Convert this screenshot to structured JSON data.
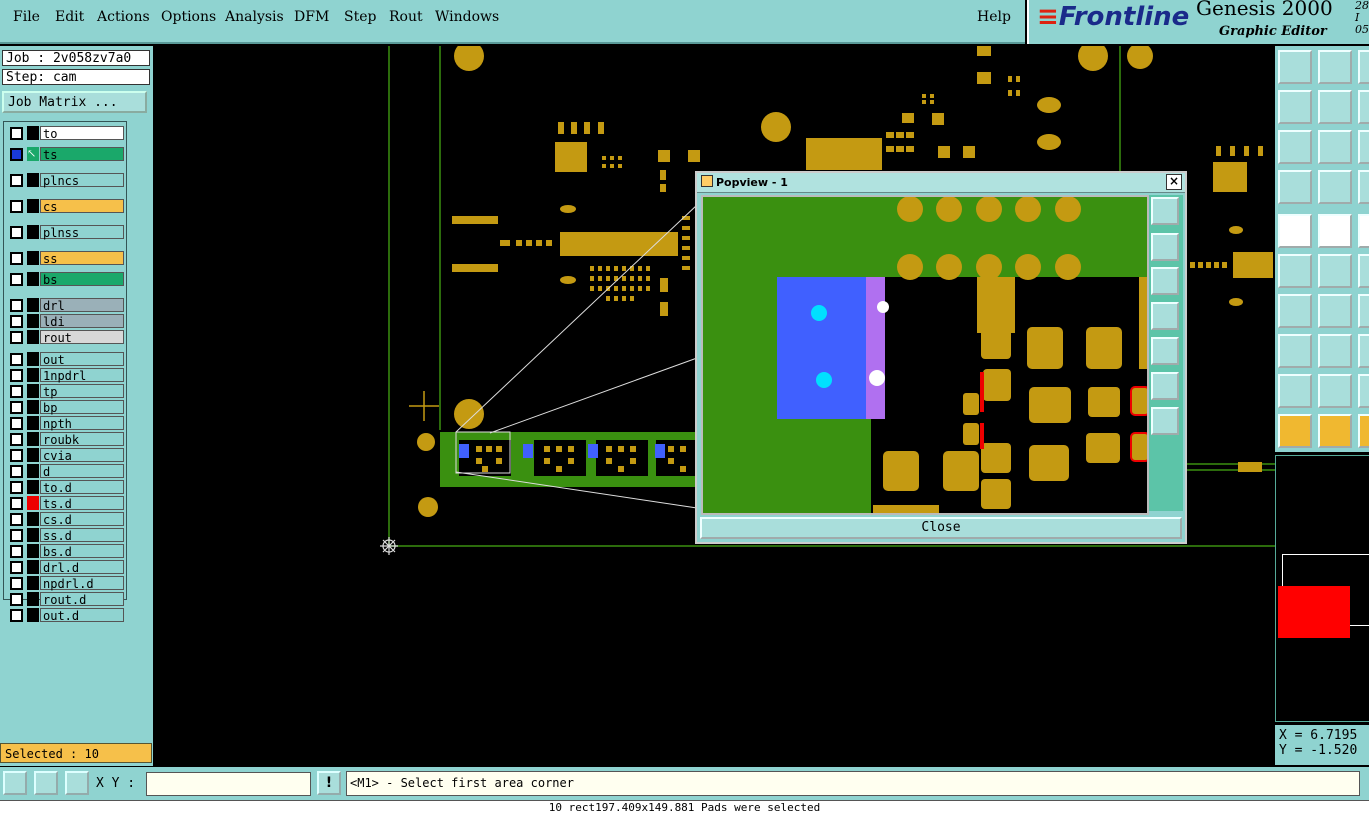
{
  "menu": [
    "File",
    "Edit",
    "Actions",
    "Options",
    "Analysis",
    "DFM",
    "Step",
    "Rout",
    "Windows"
  ],
  "help": "Help",
  "brand": {
    "logo": "Frontline",
    "title": "Genesis 2000",
    "subtitle": "Graphic Editor",
    "date_line1": "28 I",
    "date_line2": "05"
  },
  "job": "Job : 2v058zv7a0",
  "step": "Step: cam",
  "job_matrix": "Job Matrix ...",
  "layers": [
    {
      "name": "to",
      "color": "#ffffff"
    },
    {
      "name": "ts",
      "color": "#1aa86a",
      "active": true
    },
    {
      "name": "plncs",
      "color": "#8fd3d0"
    },
    {
      "name": "cs",
      "color": "#f6c04a"
    },
    {
      "name": "plnss",
      "color": "#8fd3d0"
    },
    {
      "name": "ss",
      "color": "#f6c04a"
    },
    {
      "name": "bs",
      "color": "#1aa86a"
    },
    {
      "name": "drl",
      "color": "#9ab0b8"
    },
    {
      "name": "ldi",
      "color": "#9ab0b8"
    },
    {
      "name": "rout",
      "color": "#d8d8d8"
    },
    {
      "name": "out",
      "color": "#8fd3d0"
    },
    {
      "name": "1npdrl",
      "color": "#8fd3d0"
    },
    {
      "name": "tp",
      "color": "#8fd3d0"
    },
    {
      "name": "bp",
      "color": "#8fd3d0"
    },
    {
      "name": "npth",
      "color": "#8fd3d0"
    },
    {
      "name": "roubk",
      "color": "#8fd3d0"
    },
    {
      "name": "cvia",
      "color": "#8fd3d0"
    },
    {
      "name": "d",
      "color": "#8fd3d0"
    },
    {
      "name": "to.d",
      "color": "#8fd3d0"
    },
    {
      "name": "ts.d",
      "color": "#8fd3d0"
    },
    {
      "name": "cs.d",
      "color": "#8fd3d0"
    },
    {
      "name": "ss.d",
      "color": "#8fd3d0"
    },
    {
      "name": "bs.d",
      "color": "#8fd3d0"
    },
    {
      "name": "drl.d",
      "color": "#8fd3d0"
    },
    {
      "name": "npdrl.d",
      "color": "#8fd3d0"
    },
    {
      "name": "rout.d",
      "color": "#8fd3d0"
    },
    {
      "name": "out.d",
      "color": "#8fd3d0"
    }
  ],
  "selected": "Selected : 10",
  "xy_label": "X Y :",
  "xy_value": "",
  "prompt": "<M1> - Select first area corner",
  "status": "10 rect197.409x149.881 Pads were selected",
  "coords": {
    "x": "X = 6.7195",
    "y": "Y = -1.520"
  },
  "popview": {
    "title": "Popview - 1",
    "close": "Close"
  },
  "colors": {
    "panel": "#8fd3d0",
    "copper": "#c49a12",
    "mask": "#3a9010",
    "pad_blue": "#4060ff",
    "magenta": "#b070f0"
  }
}
